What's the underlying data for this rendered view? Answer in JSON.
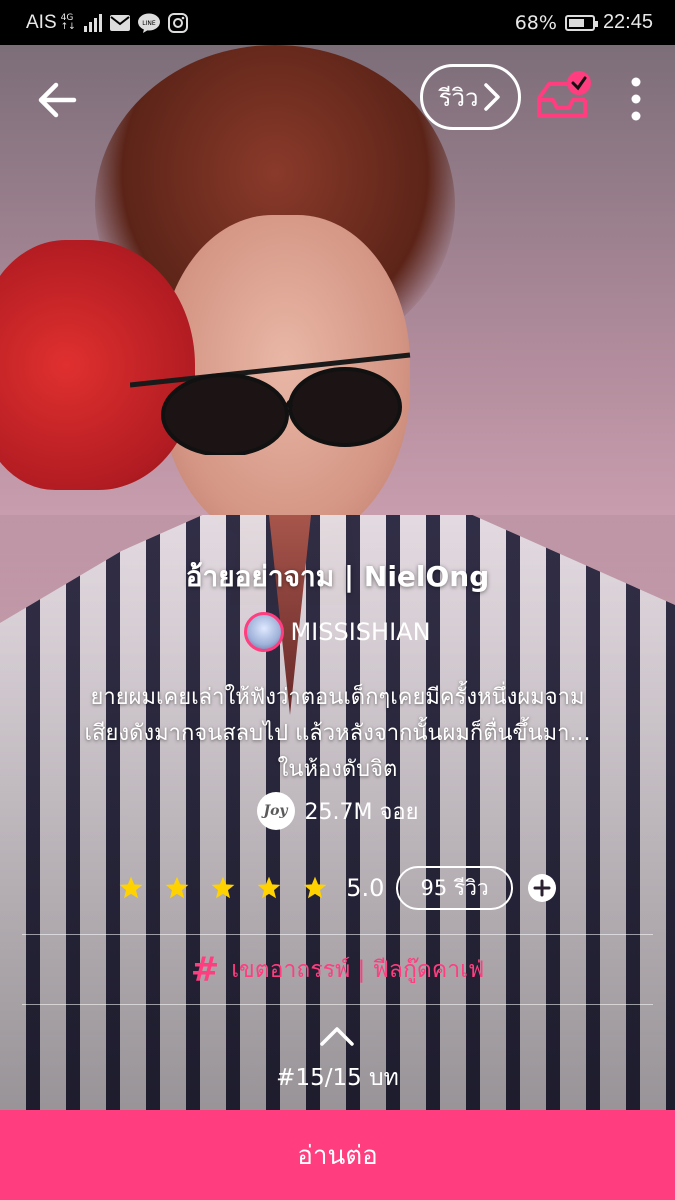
{
  "status_bar": {
    "carrier": "AIS",
    "network": "4G",
    "battery": "68%",
    "battery_level": 0.68,
    "time": "22:45",
    "icons": [
      "signal-icon",
      "mail-icon",
      "line-icon",
      "instagram-icon",
      "battery-icon"
    ]
  },
  "toolbar": {
    "back_icon": "arrow-left-icon",
    "review_label": "รีวิว",
    "library_icon": "library-check-icon",
    "more_icon": "more-vertical-icon"
  },
  "story": {
    "title": "อ้ายอย่าจาม | NielOng",
    "author": "MISSISHIAN",
    "synopsis_line1": "ยายผมเคยเล่าให้ฟังว่าตอนเด็กๆเคยมีครั้งหนึ่งผมจาม",
    "synopsis_line2": "เสียงดังมากจนสลบไป แล้วหลังจากนั้นผมก็ตื่นขึ้นมา...",
    "synopsis_line3": "ในห้องดับจิต",
    "joy_badge": "Joy",
    "views": "25.7M จอย",
    "rating_stars": 5,
    "rating": "5.0",
    "reviews": "95 รีวิว",
    "tags": "เขตอาถรรพ์ | ฟีลกู๊ดคาเฟ่",
    "episode": "#15/15 บท"
  },
  "actions": {
    "read_label": "อ่านต่อ"
  },
  "colors": {
    "accent": "#ff3d7f",
    "star": "#ffd200",
    "status_bg": "#000000"
  }
}
